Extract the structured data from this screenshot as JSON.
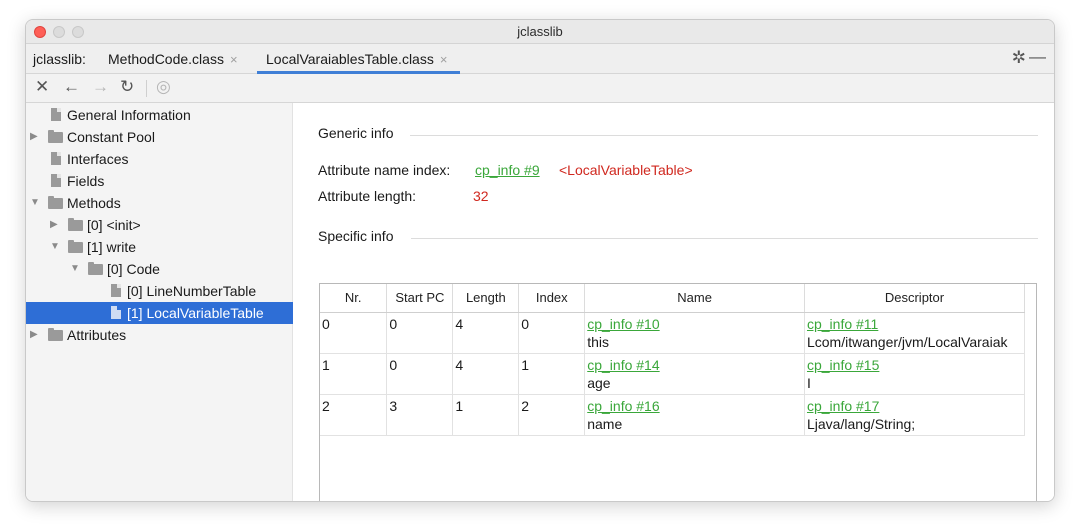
{
  "window": {
    "title": "jclasslib"
  },
  "tabs": {
    "prefix": "jclasslib:",
    "items": [
      {
        "label": "MethodCode.class",
        "close": "×"
      },
      {
        "label": "LocalVaraiablesTable.class",
        "close": "×"
      }
    ]
  },
  "colors": {
    "accent": "#2e6ed6",
    "link": "#3aa73a",
    "value": "#d0281f"
  },
  "toolbar": {
    "icons": [
      "close-icon",
      "back-icon",
      "forward-icon",
      "refresh-icon",
      "web-icon"
    ]
  },
  "sidebar": {
    "items": [
      {
        "label": "General Information"
      },
      {
        "label": "Constant Pool"
      },
      {
        "label": "Interfaces"
      },
      {
        "label": "Fields"
      },
      {
        "label": "Methods"
      },
      {
        "label": "[0] <init>"
      },
      {
        "label": "[1] write"
      },
      {
        "label": "[0] Code"
      },
      {
        "label": "[0] LineNumberTable"
      },
      {
        "label": "[1] LocalVariableTable"
      },
      {
        "label": "Attributes"
      }
    ]
  },
  "main": {
    "generic_info": "Generic info",
    "attr_name_index_label": "Attribute name index:",
    "attr_name_index_link": "cp_info #9",
    "attr_name_index_value": "<LocalVariableTable>",
    "attr_length_label": "Attribute length:",
    "attr_length_value": "32",
    "specific_info": "Specific info",
    "table": {
      "headers": [
        "Nr.",
        "Start PC",
        "Length",
        "Index",
        "Name",
        "Descriptor"
      ],
      "rows": [
        {
          "nr": "0",
          "start_pc": "0",
          "length": "4",
          "index": "0",
          "name_link": "cp_info #10",
          "name": "this",
          "desc_link": "cp_info #11",
          "desc": "Lcom/itwanger/jvm/LocalVaraiak"
        },
        {
          "nr": "1",
          "start_pc": "0",
          "length": "4",
          "index": "1",
          "name_link": "cp_info #14",
          "name": "age",
          "desc_link": "cp_info #15",
          "desc": "I"
        },
        {
          "nr": "2",
          "start_pc": "3",
          "length": "1",
          "index": "2",
          "name_link": "cp_info #16",
          "name": "name",
          "desc_link": "cp_info #17",
          "desc": "Ljava/lang/String;"
        }
      ]
    }
  }
}
